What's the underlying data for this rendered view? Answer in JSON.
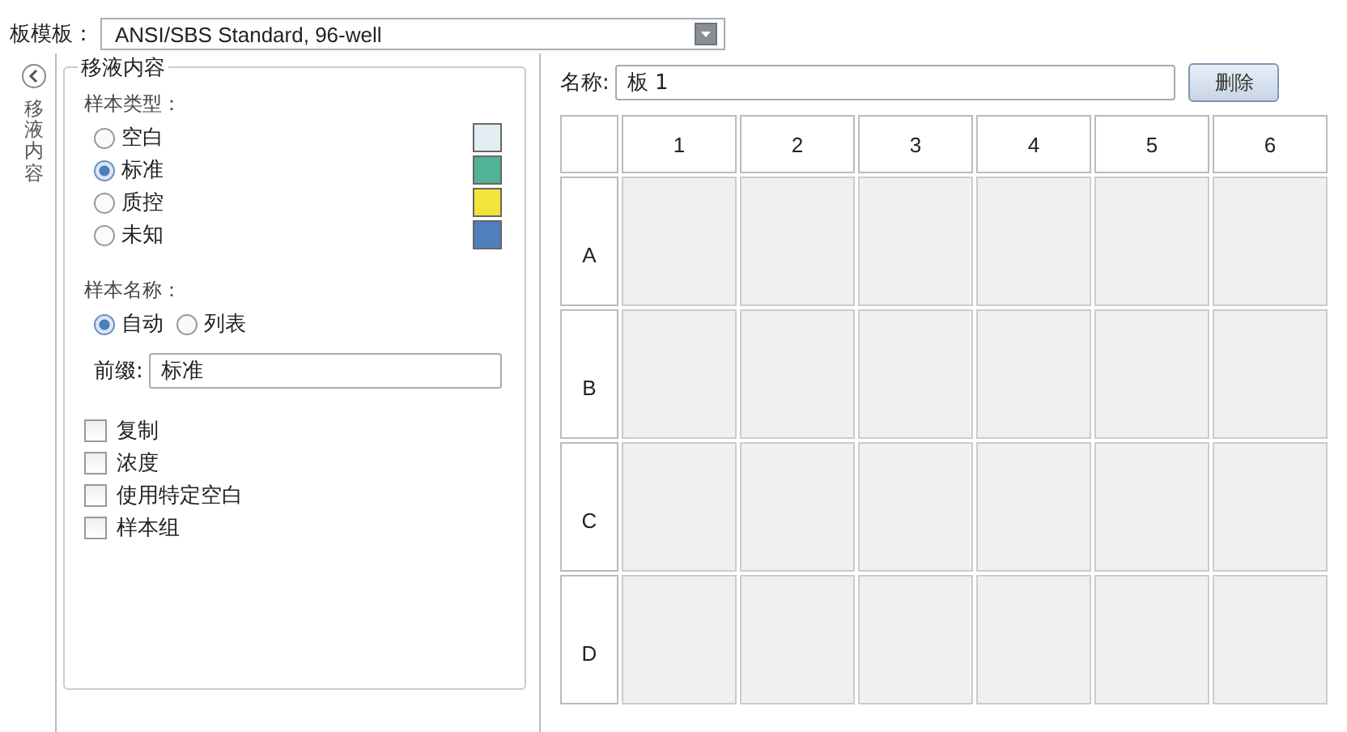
{
  "plate_template": {
    "label": "板模板：",
    "value": "ANSI/SBS Standard, 96-well"
  },
  "side_tab": {
    "label": "移液内容"
  },
  "pipetting": {
    "title": "移液内容",
    "sample_type": {
      "label": "样本类型：",
      "options": [
        {
          "label": "空白",
          "selected": false,
          "color": "#e3eef2"
        },
        {
          "label": "标准",
          "selected": true,
          "color": "#52b297"
        },
        {
          "label": "质控",
          "selected": false,
          "color": "#f3e33a"
        },
        {
          "label": "未知",
          "selected": false,
          "color": "#4f7fbd"
        }
      ]
    },
    "sample_name": {
      "label": "样本名称：",
      "options": [
        {
          "label": "自动",
          "selected": true
        },
        {
          "label": "列表",
          "selected": false
        }
      ],
      "prefix": {
        "label": "前缀:",
        "value": "标准"
      }
    },
    "checkboxes": [
      {
        "label": "复制",
        "checked": false
      },
      {
        "label": "浓度",
        "checked": false
      },
      {
        "label": "使用特定空白",
        "checked": false
      },
      {
        "label": "样本组",
        "checked": false
      }
    ]
  },
  "plate": {
    "name_label": "名称:",
    "name_value": "板 1",
    "delete_button": "删除",
    "columns": [
      "1",
      "2",
      "3",
      "4",
      "5",
      "6"
    ],
    "rows": [
      "A",
      "B",
      "C",
      "D"
    ]
  }
}
